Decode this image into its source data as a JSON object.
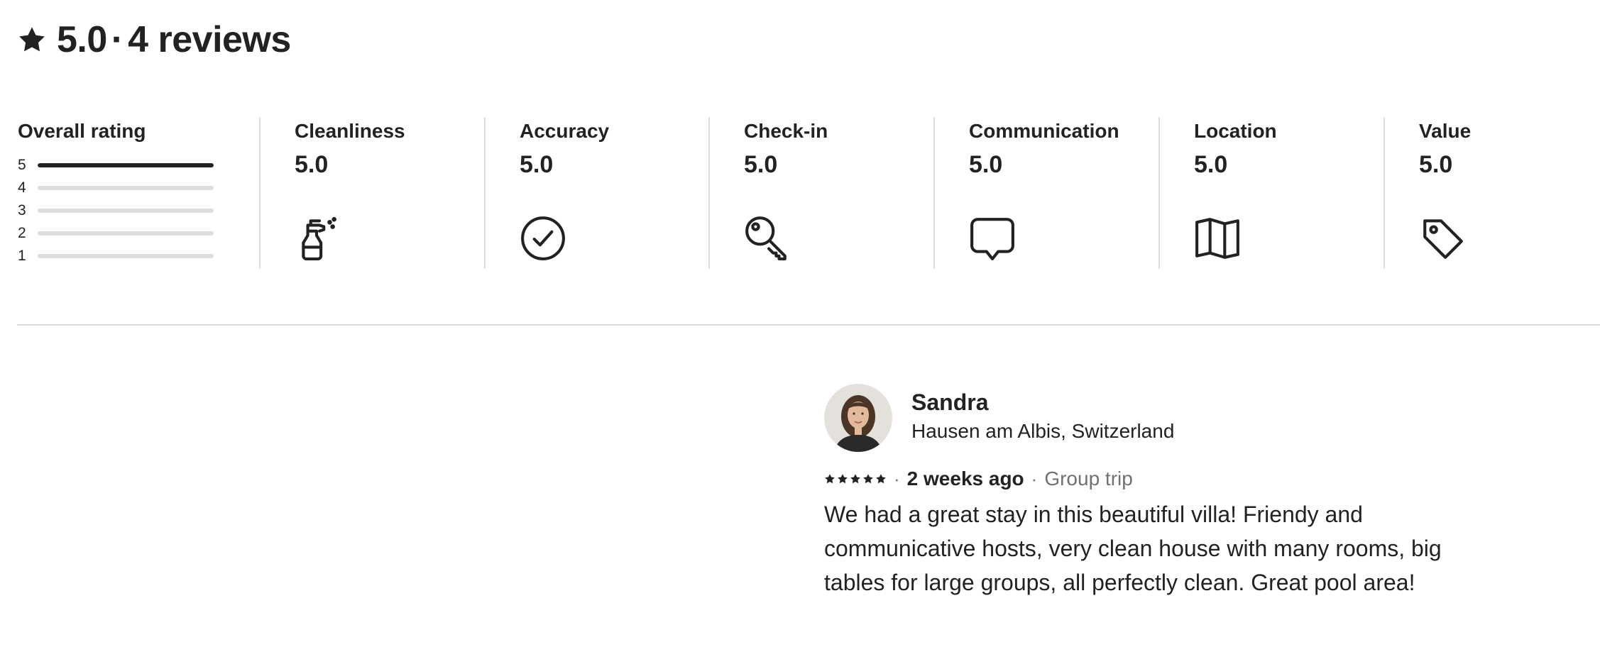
{
  "header": {
    "rating": "5.0",
    "separator": "·",
    "reviews": "4 reviews",
    "icon": "star-icon"
  },
  "overall": {
    "label": "Overall rating",
    "distribution": [
      {
        "stars": "5",
        "fraction": 1.0
      },
      {
        "stars": "4",
        "fraction": 0.0
      },
      {
        "stars": "3",
        "fraction": 0.0
      },
      {
        "stars": "2",
        "fraction": 0.0
      },
      {
        "stars": "1",
        "fraction": 0.0
      }
    ]
  },
  "categories": [
    {
      "label": "Cleanliness",
      "score": "5.0",
      "icon": "spray-bottle-icon"
    },
    {
      "label": "Accuracy",
      "score": "5.0",
      "icon": "check-circle-icon"
    },
    {
      "label": "Check-in",
      "score": "5.0",
      "icon": "key-icon"
    },
    {
      "label": "Communication",
      "score": "5.0",
      "icon": "chat-bubble-icon"
    },
    {
      "label": "Location",
      "score": "5.0",
      "icon": "map-icon"
    },
    {
      "label": "Value",
      "score": "5.0",
      "icon": "tag-icon"
    }
  ],
  "review": {
    "name": "Sandra",
    "location": "Hausen am Albis, Switzerland",
    "stars": 5,
    "separator": "·",
    "date": "2 weeks ago",
    "trip_type": "Group trip",
    "text": "We had a great stay in this beautiful villa! Friendy and communicative hosts, very clean house with many rooms, big tables for large groups, all perfectly clean. Great pool area!"
  },
  "colors": {
    "text": "#222222",
    "muted": "#717171",
    "divider": "#dddddd"
  }
}
